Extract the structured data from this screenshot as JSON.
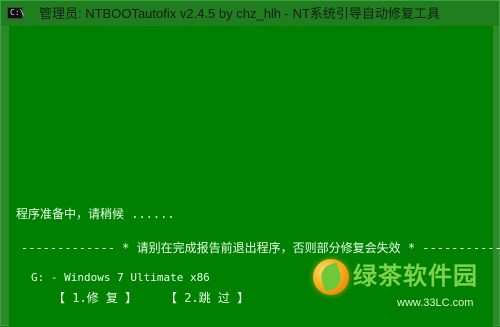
{
  "window": {
    "icon_label": "C:\\",
    "title": "管理员:  NTBOOTautofix v2.4.5 by chz_hlh - NT系统引导自动修复工具"
  },
  "console": {
    "status_line": "程序准备中，请稍候 ......",
    "warning_line": "------------- * 请别在完成报告前退出程序，否则部分修复会失效 * ------------",
    "os_line": "G: - Windows 7 Ultimate x86",
    "buttons": {
      "repair": "【  1.修  复  】",
      "skip": "【  2.跳  过  】"
    }
  },
  "watermark": {
    "logo_text": "绿茶软件园",
    "url": "www.33LC.com"
  }
}
